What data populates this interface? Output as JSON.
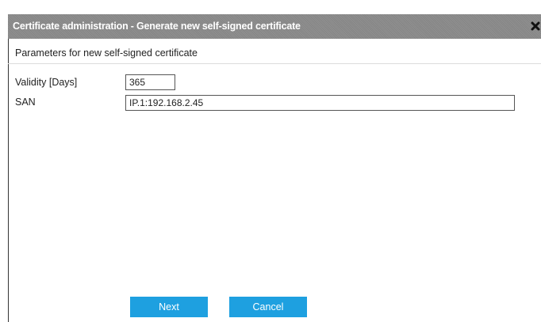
{
  "dialog": {
    "title": "Certificate administration - Generate new self-signed certificate",
    "close_icon": "close-icon",
    "subtitle": "Parameters for new self-signed certificate"
  },
  "form": {
    "validity": {
      "label": "Validity [Days]",
      "value": "365"
    },
    "san": {
      "label": "SAN",
      "value": "IP.1:192.168.2.45"
    }
  },
  "buttons": {
    "next_label": "Next",
    "cancel_label": "Cancel"
  },
  "colors": {
    "titlebar": "#8a8a8a",
    "button": "#1ea0e0",
    "button_text": "#ffffff"
  }
}
